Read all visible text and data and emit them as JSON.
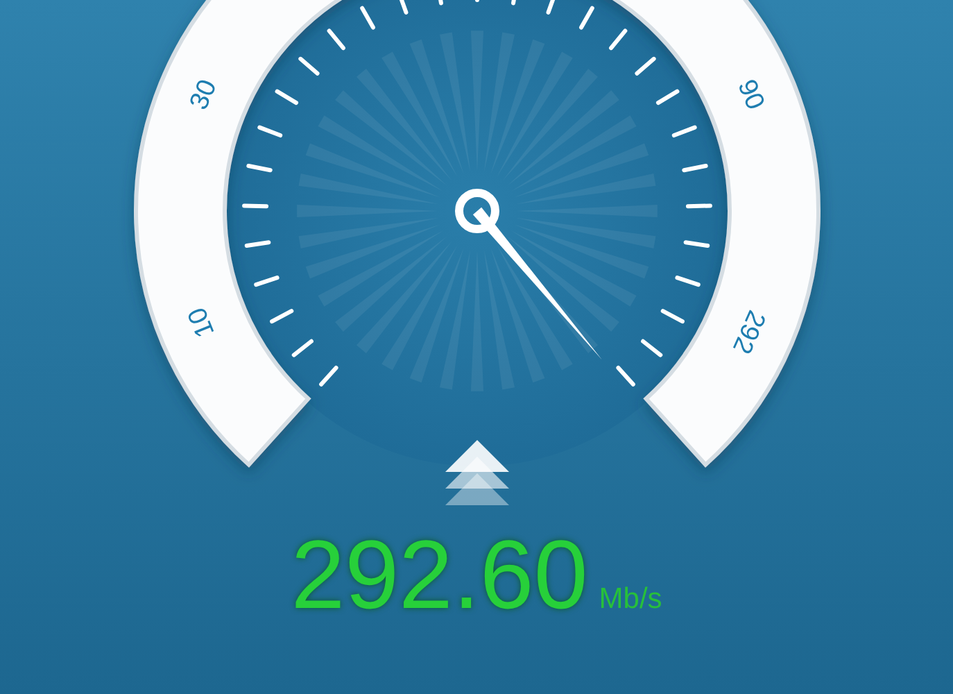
{
  "gauge": {
    "scale_labels": [
      "10",
      "30",
      "90",
      "292"
    ]
  },
  "speed": {
    "value": "292.60",
    "unit": "Mb/s"
  }
}
